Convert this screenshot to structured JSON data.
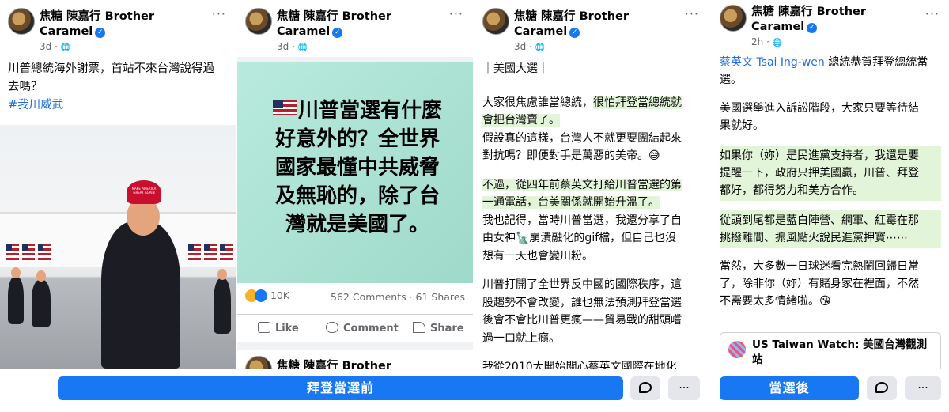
{
  "common": {
    "author_line1": "焦糖 陳嘉行 Brother",
    "author_line2": "Caramel",
    "verified_glyph": "✓",
    "dots": "···",
    "globe": "🌐"
  },
  "panel1": {
    "time": "3d",
    "text_line1": "川普總統海外謝票，首站不來台灣說得過",
    "text_line2": "去嗎？",
    "hashtag": "#我川威武",
    "cap_text": "MAKE AMERICA GREAT AGAIN"
  },
  "panel2": {
    "time": "3d",
    "card_lines": [
      "川普當選有什麼",
      "好意外的？全世界",
      "國家最懂中共威脅",
      "及無恥的，除了台",
      "灣就是美國了。"
    ],
    "reaction_count": "10K",
    "comments": "562 Comments",
    "shares": "61 Shares",
    "like_label": "Like",
    "comment_label": "Comment",
    "share_label": "Share",
    "next_author": "焦糖 陳嘉行 Brother"
  },
  "panel3": {
    "time": "3d",
    "section": "｜美國大選｜",
    "p1_a": "大家很焦慮誰當總統，",
    "p1_b": "很怕拜登當總統就",
    "p1_c": "會把台灣賣了。",
    "p1_d": "假設真的這樣，台灣人不就更要團結起來",
    "p1_e": "對抗嗎？即便對手是萬惡的美帝。😅",
    "p2_a": "不過，從四年前蔡英文打給川普當選的第",
    "p2_b": "一通電話，台美關係就開始升溫了。",
    "p2_c": "我也記得，當時川普當選，我還分享了自",
    "p2_d": "由女神🗽崩潰融化的gif檔，但自己也沒",
    "p2_e": "想有一天也會變川粉。",
    "p3_a": "川普打開了全世界反中國的國際秩序，這",
    "p3_b": "股趨勢不會改變，誰也無法預測拜登當選",
    "p3_c": "後會不會比川普更瘋——貿易戰的甜頭嚐",
    "p3_d": "過一口就上癮。",
    "p4_partial": "我從2010大開始關心蔡英文國際在地化"
  },
  "panel4": {
    "time": "2h",
    "mention": "蔡英文 Tsai Ing-wen",
    "p1_a": " 總統恭賀拜登總統當",
    "p1_b": "選。",
    "p2_a": "美國選舉進入訴訟階段，大家只要等待結",
    "p2_b": "果就好。",
    "p3_a": "如果你（妳）是民進黨支持者，我還是要",
    "p3_b": "提醒一下，政府只押美國贏，川普、拜登",
    "p3_c": "都好，都得努力和美方合作。",
    "p4_a": "從頭到尾都是藍白陣營、網軍、紅霉在那",
    "p4_b": "挑撥離間、搧風點火說民進黨押寶⋯⋯",
    "p5_a": "當然，大多數一日球迷看完熱鬧回歸日常",
    "p5_b": "了，除非你（妳）有賭身家在裡面，不然",
    "p5_c": "不需要太多情緒啦。😘",
    "link_title_a": "US Taiwan Watch: 美國台灣觀測",
    "link_title_b": "站"
  },
  "bottom": {
    "before_label": "拜登當選前",
    "after_label": "當選後",
    "more_label": "···"
  },
  "colors": {
    "fb_blue": "#1877f2",
    "highlight_green": "#e2f5d8",
    "card_green": "#a9e2d3"
  }
}
